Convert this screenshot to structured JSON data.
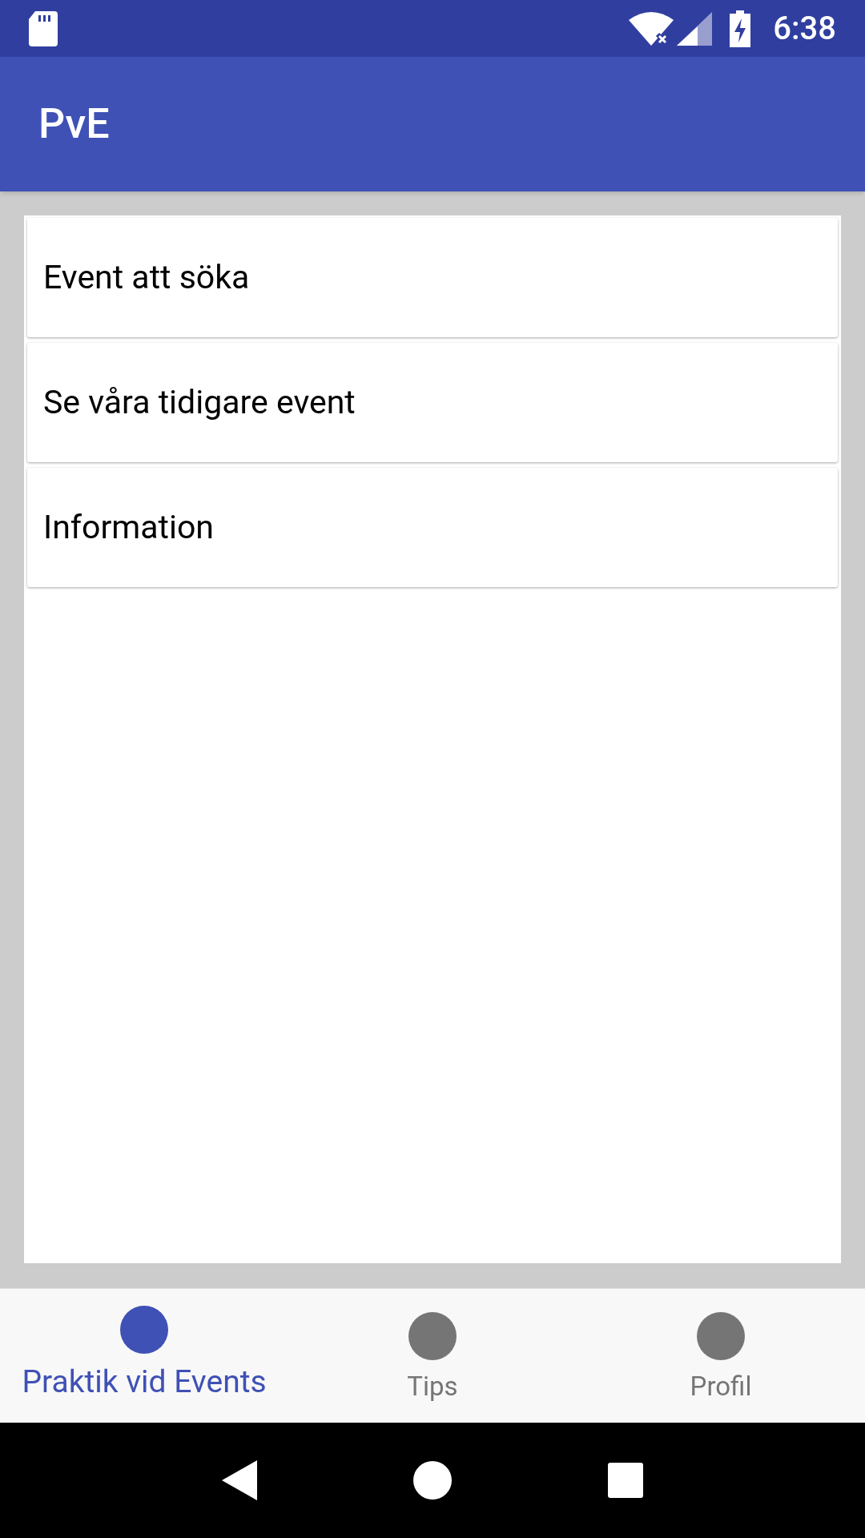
{
  "status_bar": {
    "time": "6:38"
  },
  "app_bar": {
    "title": "PvE"
  },
  "menu_items": [
    {
      "label": "Event att söka"
    },
    {
      "label": "Se våra tidigare event"
    },
    {
      "label": "Information"
    }
  ],
  "bottom_nav": [
    {
      "label": "Praktik vid Events",
      "selected": true
    },
    {
      "label": "Tips",
      "selected": false
    },
    {
      "label": "Profil",
      "selected": false
    }
  ]
}
